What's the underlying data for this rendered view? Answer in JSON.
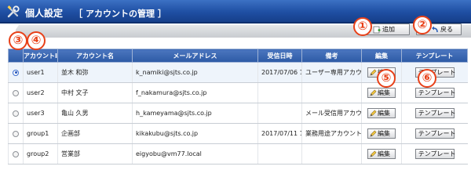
{
  "header": {
    "title": "個人設定",
    "subtitle": "［ アカウントの管理 ］"
  },
  "toolbar": {
    "add_label": "追加",
    "back_label": "戻る"
  },
  "badges": [
    "①",
    "②",
    "③",
    "④",
    "⑤",
    "⑥"
  ],
  "table": {
    "columns": [
      "",
      "アカウントID",
      "アカウント名",
      "メールアドレス",
      "受信日時",
      "備考",
      "編集",
      "テンプレート"
    ],
    "edit_label": "編集",
    "template_label": "テンプレート",
    "rows": [
      {
        "selected": true,
        "id": "user1",
        "name": "並木 和弥",
        "email": "k_namiki@sjts.co.jp",
        "date": "2017/07/06 18:27:40",
        "note": "ユーザー専用アカウント"
      },
      {
        "selected": false,
        "id": "user2",
        "name": "中村 文子",
        "email": "f_nakamura@sjts.co.jp",
        "date": "",
        "note": ""
      },
      {
        "selected": false,
        "id": "user3",
        "name": "亀山 久男",
        "email": "h_kameyama@sjts.co.jp",
        "date": "",
        "note": "メール受信用アカウント"
      },
      {
        "selected": false,
        "id": "group1",
        "name": "企画部",
        "email": "kikakubu@sjts.co.jp",
        "date": "2017/07/11 14:13:38",
        "note": "業務用途アカウント"
      },
      {
        "selected": false,
        "id": "group2",
        "name": "営業部",
        "email": "eigyobu@vm77.local",
        "date": "",
        "note": ""
      }
    ]
  },
  "colors": {
    "header_blue": "#1f4fa3",
    "badge_red": "#e84018"
  }
}
